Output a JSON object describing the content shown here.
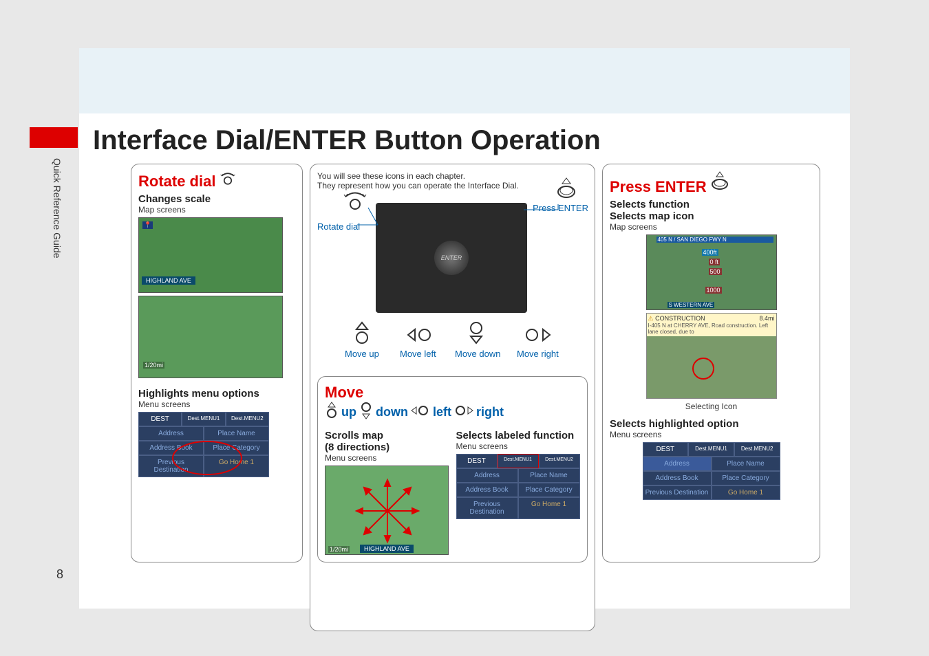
{
  "page": {
    "title": "Interface Dial/ENTER Button Operation",
    "sidebar_label": "Quick Reference Guide",
    "page_number": "8"
  },
  "left": {
    "heading": "Rotate dial",
    "changes_scale": "Changes scale",
    "map_screens": "Map screens",
    "highlights": "Highlights menu options",
    "menu_screens": "Menu screens",
    "map_label": "HIGHLAND AVE",
    "dest_hdr": "DEST",
    "dest_menu1": "Dest.MENU1",
    "dest_menu2": "Dest.MENU2",
    "btn_address": "Address",
    "btn_address_book": "Address Book",
    "btn_prev_dest": "Previous Destination",
    "btn_place_name": "Place Name",
    "btn_place_cat": "Place Category",
    "btn_go_home": "Go Home 1"
  },
  "mid": {
    "intro1": "You will see these icons in each chapter.",
    "intro2": "They represent how you can operate the Interface Dial.",
    "rotate_dial": "Rotate dial",
    "press_enter": "Press ENTER",
    "move_up": "Move up",
    "move_left": "Move left",
    "move_down": "Move down",
    "move_right": "Move right",
    "knob": "ENTER",
    "move_heading": "Move",
    "move_string": {
      "up": "up",
      "down": "down",
      "left": "left",
      "right": "right"
    },
    "scrolls": "Scrolls map",
    "scrolls2": "(8 directions)",
    "menu_screens": "Menu screens",
    "selects_labeled": "Selects labeled function",
    "map_label2": "HIGHLAND AVE"
  },
  "right": {
    "heading": "Press ENTER",
    "selects_function": "Selects function",
    "selects_map_icon": "Selects map icon",
    "map_screens": "Map screens",
    "freeway": "405 N / SAN DIEGO FWY N",
    "dist1": "400ft",
    "dist2": "0 ft",
    "dist3": "500",
    "dist4": "1000",
    "western": "S WESTERN AVE",
    "construction_title": "CONSTRUCTION",
    "construction_dist": "8.4mi",
    "construction_body": "I-405 N at CHERRY AVE, Road construction. Left lane closed, due to",
    "selecting_icon": "Selecting Icon",
    "selects_highlighted": "Selects highlighted option",
    "menu_screens": "Menu screens"
  },
  "nav_menu": {
    "dest": "DEST",
    "m1": "Dest.MENU1",
    "m2": "Dest.MENU2",
    "address": "Address",
    "place_name": "Place Name",
    "address_book": "Address Book",
    "place_category": "Place Category",
    "prev_dest": "Previous Destination",
    "go_home": "Go Home 1"
  }
}
